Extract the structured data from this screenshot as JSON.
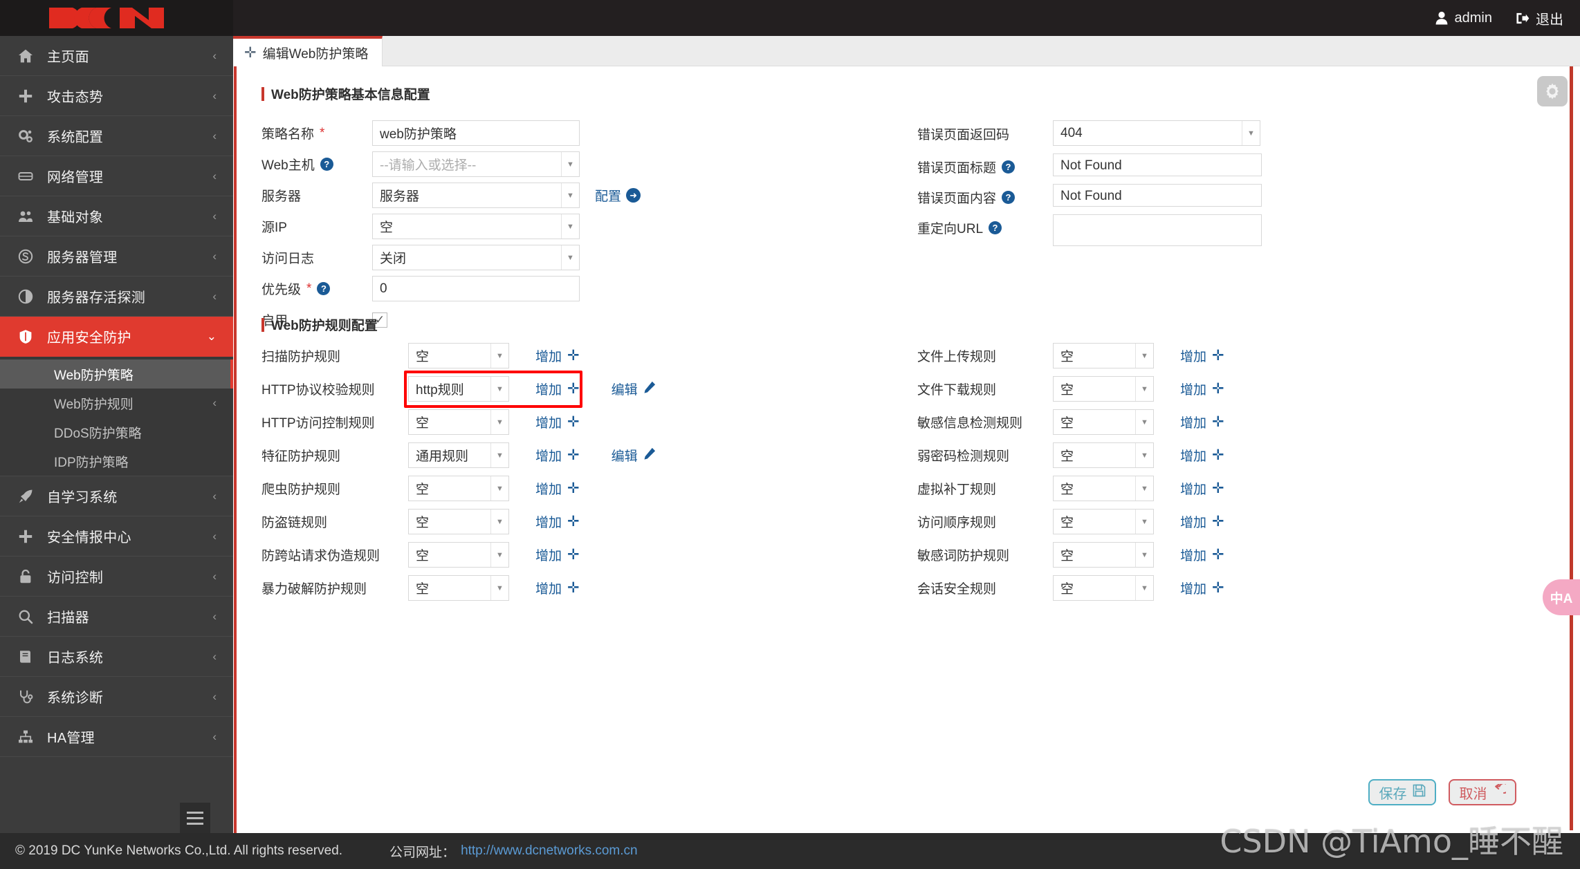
{
  "brand": {
    "logo_text": "DCN",
    "accent": "#e03a2f",
    "dark": "#3c3c3c"
  },
  "topbar": {
    "user_label": "admin",
    "logout_label": "退出"
  },
  "sidebar": {
    "items": [
      {
        "label": "主页面",
        "icon": "home-icon",
        "caret": "‹"
      },
      {
        "label": "攻击态势",
        "icon": "plus-icon",
        "caret": "‹"
      },
      {
        "label": "系统配置",
        "icon": "gears-icon",
        "caret": "‹"
      },
      {
        "label": "网络管理",
        "icon": "server-icon",
        "caret": "‹"
      },
      {
        "label": "基础对象",
        "icon": "users-icon",
        "caret": "‹"
      },
      {
        "label": "服务器管理",
        "icon": "circle-s-icon",
        "caret": "‹"
      },
      {
        "label": "服务器存活探测",
        "icon": "half-circle-icon",
        "caret": "‹"
      },
      {
        "label": "应用安全防护",
        "icon": "shield-icon",
        "caret": "⌄",
        "active": true
      },
      {
        "label": "自学习系统",
        "icon": "rocket-icon",
        "caret": "‹"
      },
      {
        "label": "安全情报中心",
        "icon": "plus-icon",
        "caret": "‹"
      },
      {
        "label": "访问控制",
        "icon": "lock-icon",
        "caret": "‹"
      },
      {
        "label": "扫描器",
        "icon": "search-icon",
        "caret": "‹"
      },
      {
        "label": "日志系统",
        "icon": "book-icon",
        "caret": "‹"
      },
      {
        "label": "系统诊断",
        "icon": "stethoscope-icon",
        "caret": "‹"
      },
      {
        "label": "HA管理",
        "icon": "sitemap-icon",
        "caret": "‹"
      }
    ],
    "submenu": [
      {
        "label": "Web防护策略",
        "active": true,
        "caret": ""
      },
      {
        "label": "Web防护规则",
        "active": false,
        "caret": "‹"
      },
      {
        "label": "DDoS防护策略",
        "active": false,
        "caret": ""
      },
      {
        "label": "IDP防护策略",
        "active": false,
        "caret": ""
      }
    ]
  },
  "tab": {
    "label": "编辑Web防护策略",
    "icon": "plus-icon"
  },
  "basic_section": {
    "title": "Web防护策略基本信息配置",
    "left_fields": [
      {
        "label": "策略名称",
        "required": true,
        "help": false,
        "type": "text",
        "value": "web防护策略",
        "placeholder": ""
      },
      {
        "label": "Web主机",
        "required": false,
        "help": true,
        "type": "select",
        "value": "",
        "placeholder": "--请输入或选择--"
      },
      {
        "label": "服务器",
        "required": false,
        "help": false,
        "type": "select",
        "value": "服务器",
        "placeholder": "",
        "link": "配置"
      },
      {
        "label": "源IP",
        "required": false,
        "help": false,
        "type": "select",
        "value": "空",
        "placeholder": ""
      },
      {
        "label": "访问日志",
        "required": false,
        "help": false,
        "type": "select",
        "value": "关闭",
        "placeholder": ""
      },
      {
        "label": "优先级",
        "required": true,
        "help": true,
        "type": "text",
        "value": "0",
        "placeholder": ""
      },
      {
        "label": "启用",
        "required": false,
        "help": false,
        "type": "checkbox",
        "value": "✓",
        "placeholder": ""
      }
    ],
    "right_fields": [
      {
        "label": "错误页面返回码",
        "help": false,
        "type": "select",
        "value": "404",
        "placeholder": ""
      },
      {
        "label": "错误页面标题",
        "help": true,
        "type": "textarea",
        "value": "Not Found",
        "placeholder": ""
      },
      {
        "label": "错误页面内容",
        "help": true,
        "type": "textarea",
        "value": "Not Found",
        "placeholder": ""
      },
      {
        "label": "重定向URL",
        "help": true,
        "type": "textarea-tall",
        "value": "",
        "placeholder": ""
      }
    ]
  },
  "rules_section": {
    "title": "Web防护规则配置",
    "add_label": "增加",
    "edit_label": "编辑",
    "left_rules": [
      {
        "label": "扫描防护规则",
        "value": "空",
        "has_edit": false
      },
      {
        "label": "HTTP协议校验规则",
        "value": "http规则",
        "has_edit": true,
        "highlighted": true
      },
      {
        "label": "HTTP访问控制规则",
        "value": "空",
        "has_edit": false
      },
      {
        "label": "特征防护规则",
        "value": "通用规则",
        "has_edit": true
      },
      {
        "label": "爬虫防护规则",
        "value": "空",
        "has_edit": false
      },
      {
        "label": "防盗链规则",
        "value": "空",
        "has_edit": false
      },
      {
        "label": "防跨站请求伪造规则",
        "value": "空",
        "has_edit": false
      },
      {
        "label": "暴力破解防护规则",
        "value": "空",
        "has_edit": false
      }
    ],
    "right_rules": [
      {
        "label": "文件上传规则",
        "value": "空",
        "has_edit": false
      },
      {
        "label": "文件下载规则",
        "value": "空",
        "has_edit": false
      },
      {
        "label": "敏感信息检测规则",
        "value": "空",
        "has_edit": false
      },
      {
        "label": "弱密码检测规则",
        "value": "空",
        "has_edit": false
      },
      {
        "label": "虚拟补丁规则",
        "value": "空",
        "has_edit": false
      },
      {
        "label": "访问顺序规则",
        "value": "空",
        "has_edit": false
      },
      {
        "label": "敏感词防护规则",
        "value": "空",
        "has_edit": false
      },
      {
        "label": "会话安全规则",
        "value": "空",
        "has_edit": false
      }
    ]
  },
  "actions": {
    "save_label": "保存",
    "cancel_label": "取消"
  },
  "floating": {
    "translate_label": "中A",
    "gear": "gear-icon"
  },
  "footer": {
    "copyright": "© 2019 DC YunKe Networks Co.,Ltd. All rights reserved.",
    "site_label": "公司网址：",
    "site_url": "http://www.dcnetworks.com.cn"
  },
  "watermark": {
    "text": "CSDN @TiAmo_睡不醒"
  }
}
